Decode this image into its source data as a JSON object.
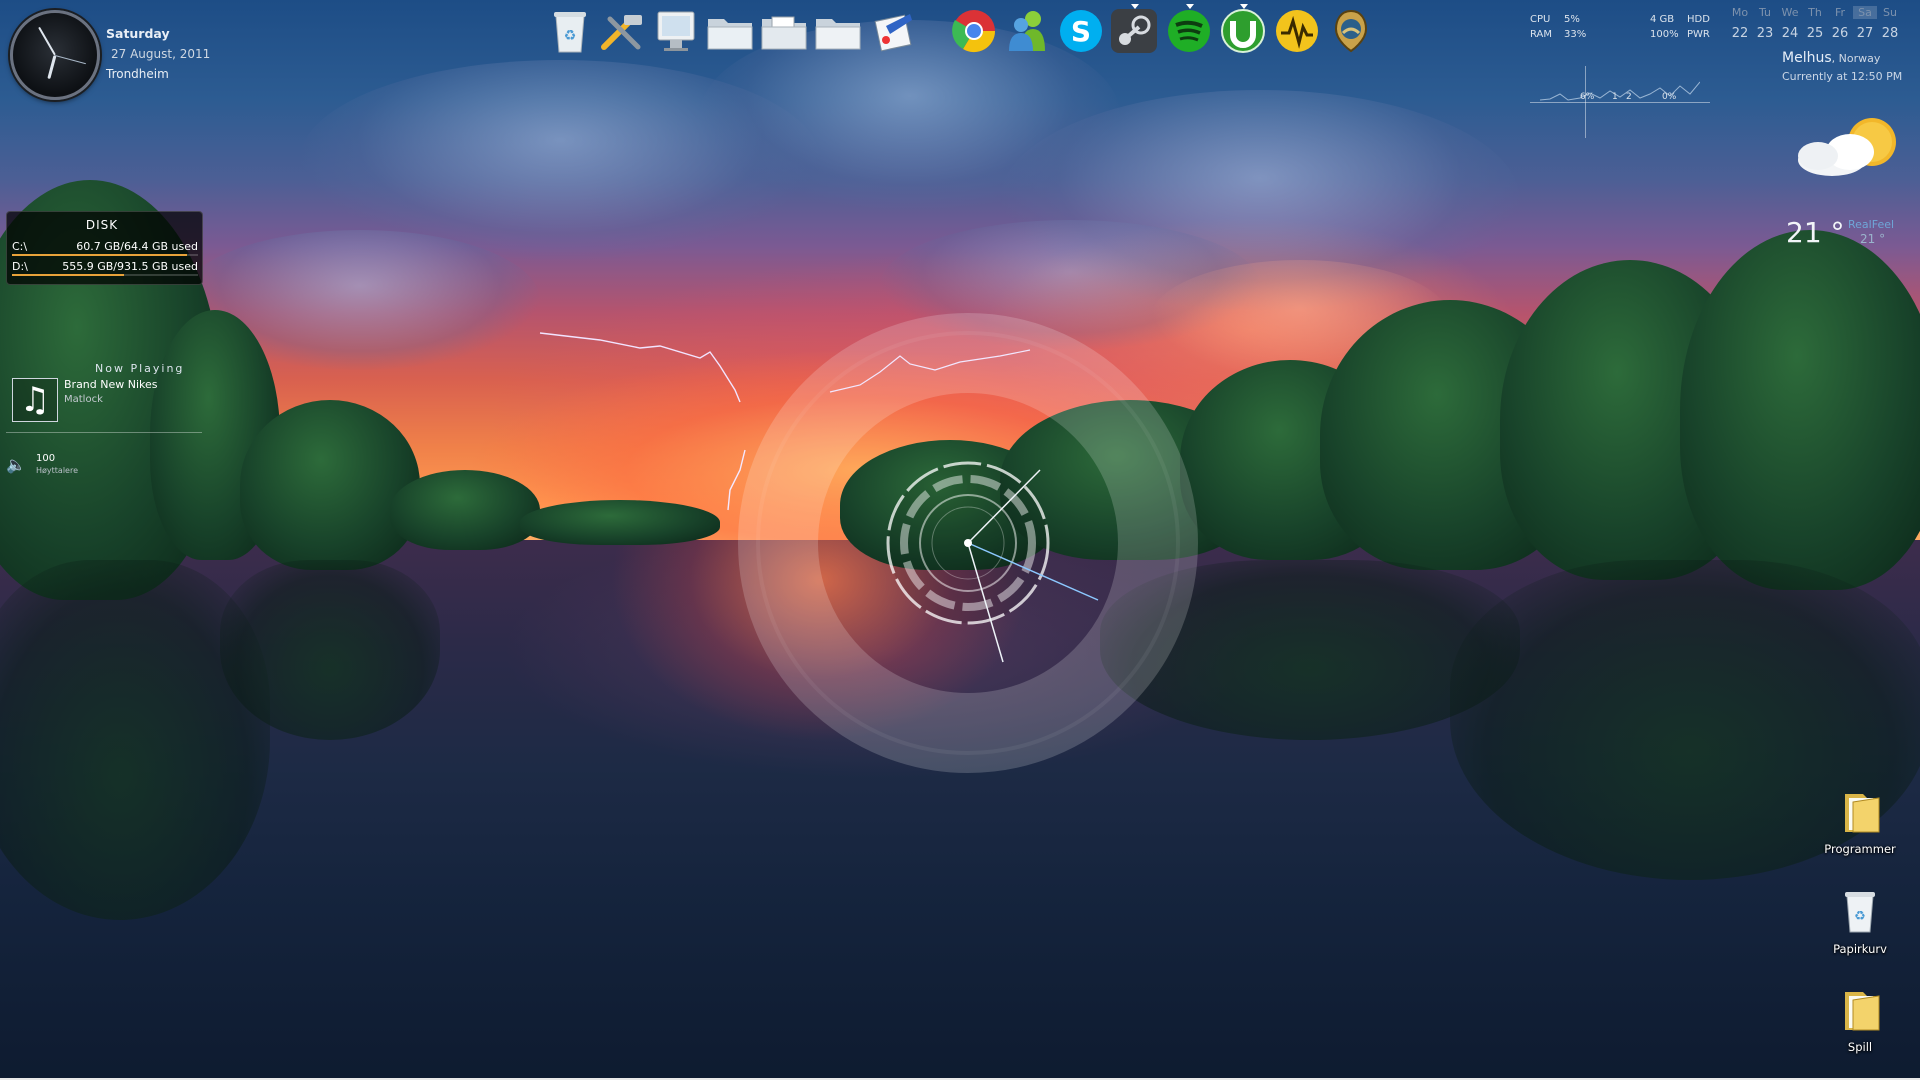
{
  "clock": {
    "day": "Saturday",
    "date": "27 August, 2011",
    "city": "Trondheim"
  },
  "disk": {
    "title": "DISK",
    "drives": [
      {
        "label": "C:\\",
        "usage": "60.7 GB/64.4 GB used",
        "fill_fraction": 0.94
      },
      {
        "label": "D:\\",
        "usage": "555.9 GB/931.5 GB used",
        "fill_fraction": 0.6
      }
    ]
  },
  "now_playing": {
    "title": "Now Playing",
    "song": "Brand New Nikes",
    "artist": "Matlock",
    "volume": "100",
    "device": "Høyttalere"
  },
  "dock": {
    "icons": [
      "recycle-bin-icon",
      "tools-icon",
      "computer-icon",
      "folder-icon",
      "documents-folder-icon",
      "folder-icon",
      "paint-icon",
      "chrome-icon",
      "messenger-icon",
      "skype-icon",
      "steam-icon",
      "spotify-icon",
      "utorrent-icon",
      "winamp-icon",
      "gps-icon"
    ]
  },
  "system": {
    "cpu_label": "CPU",
    "cpu_value": "5%",
    "ram_label": "RAM",
    "ram_value": "33%",
    "mem_value": "4 GB",
    "hdd_label": "HDD",
    "pwr_value": "100%",
    "pwr_label": "PWR",
    "graph_a": "6%",
    "graph_b": "1",
    "graph_c": "2",
    "graph_d": "0%"
  },
  "calendar": {
    "days": [
      "Mo",
      "Tu",
      "We",
      "Th",
      "Fr",
      "Sa",
      "Su"
    ],
    "dates": [
      "22",
      "23",
      "24",
      "25",
      "26",
      "27",
      "28"
    ],
    "today_index": 5
  },
  "weather": {
    "city": "Melhus",
    "country": ", Norway",
    "current": "Currently at 12:50 PM",
    "temp": "21 °",
    "realfeel_label": "RealFeel",
    "realfeel_value": "21 °",
    "icon": "partly-cloudy-icon"
  },
  "desktop": {
    "icons": [
      {
        "label": "Programmer",
        "icon": "folder-icon"
      },
      {
        "label": "Papirkurv",
        "icon": "recycle-bin-icon"
      },
      {
        "label": "Spill",
        "icon": "folder-icon"
      }
    ]
  },
  "colors": {
    "disk_bar": "#e8a33a",
    "calendar_dim": "#7d92ad",
    "realfeel": "#6fa6d8"
  }
}
